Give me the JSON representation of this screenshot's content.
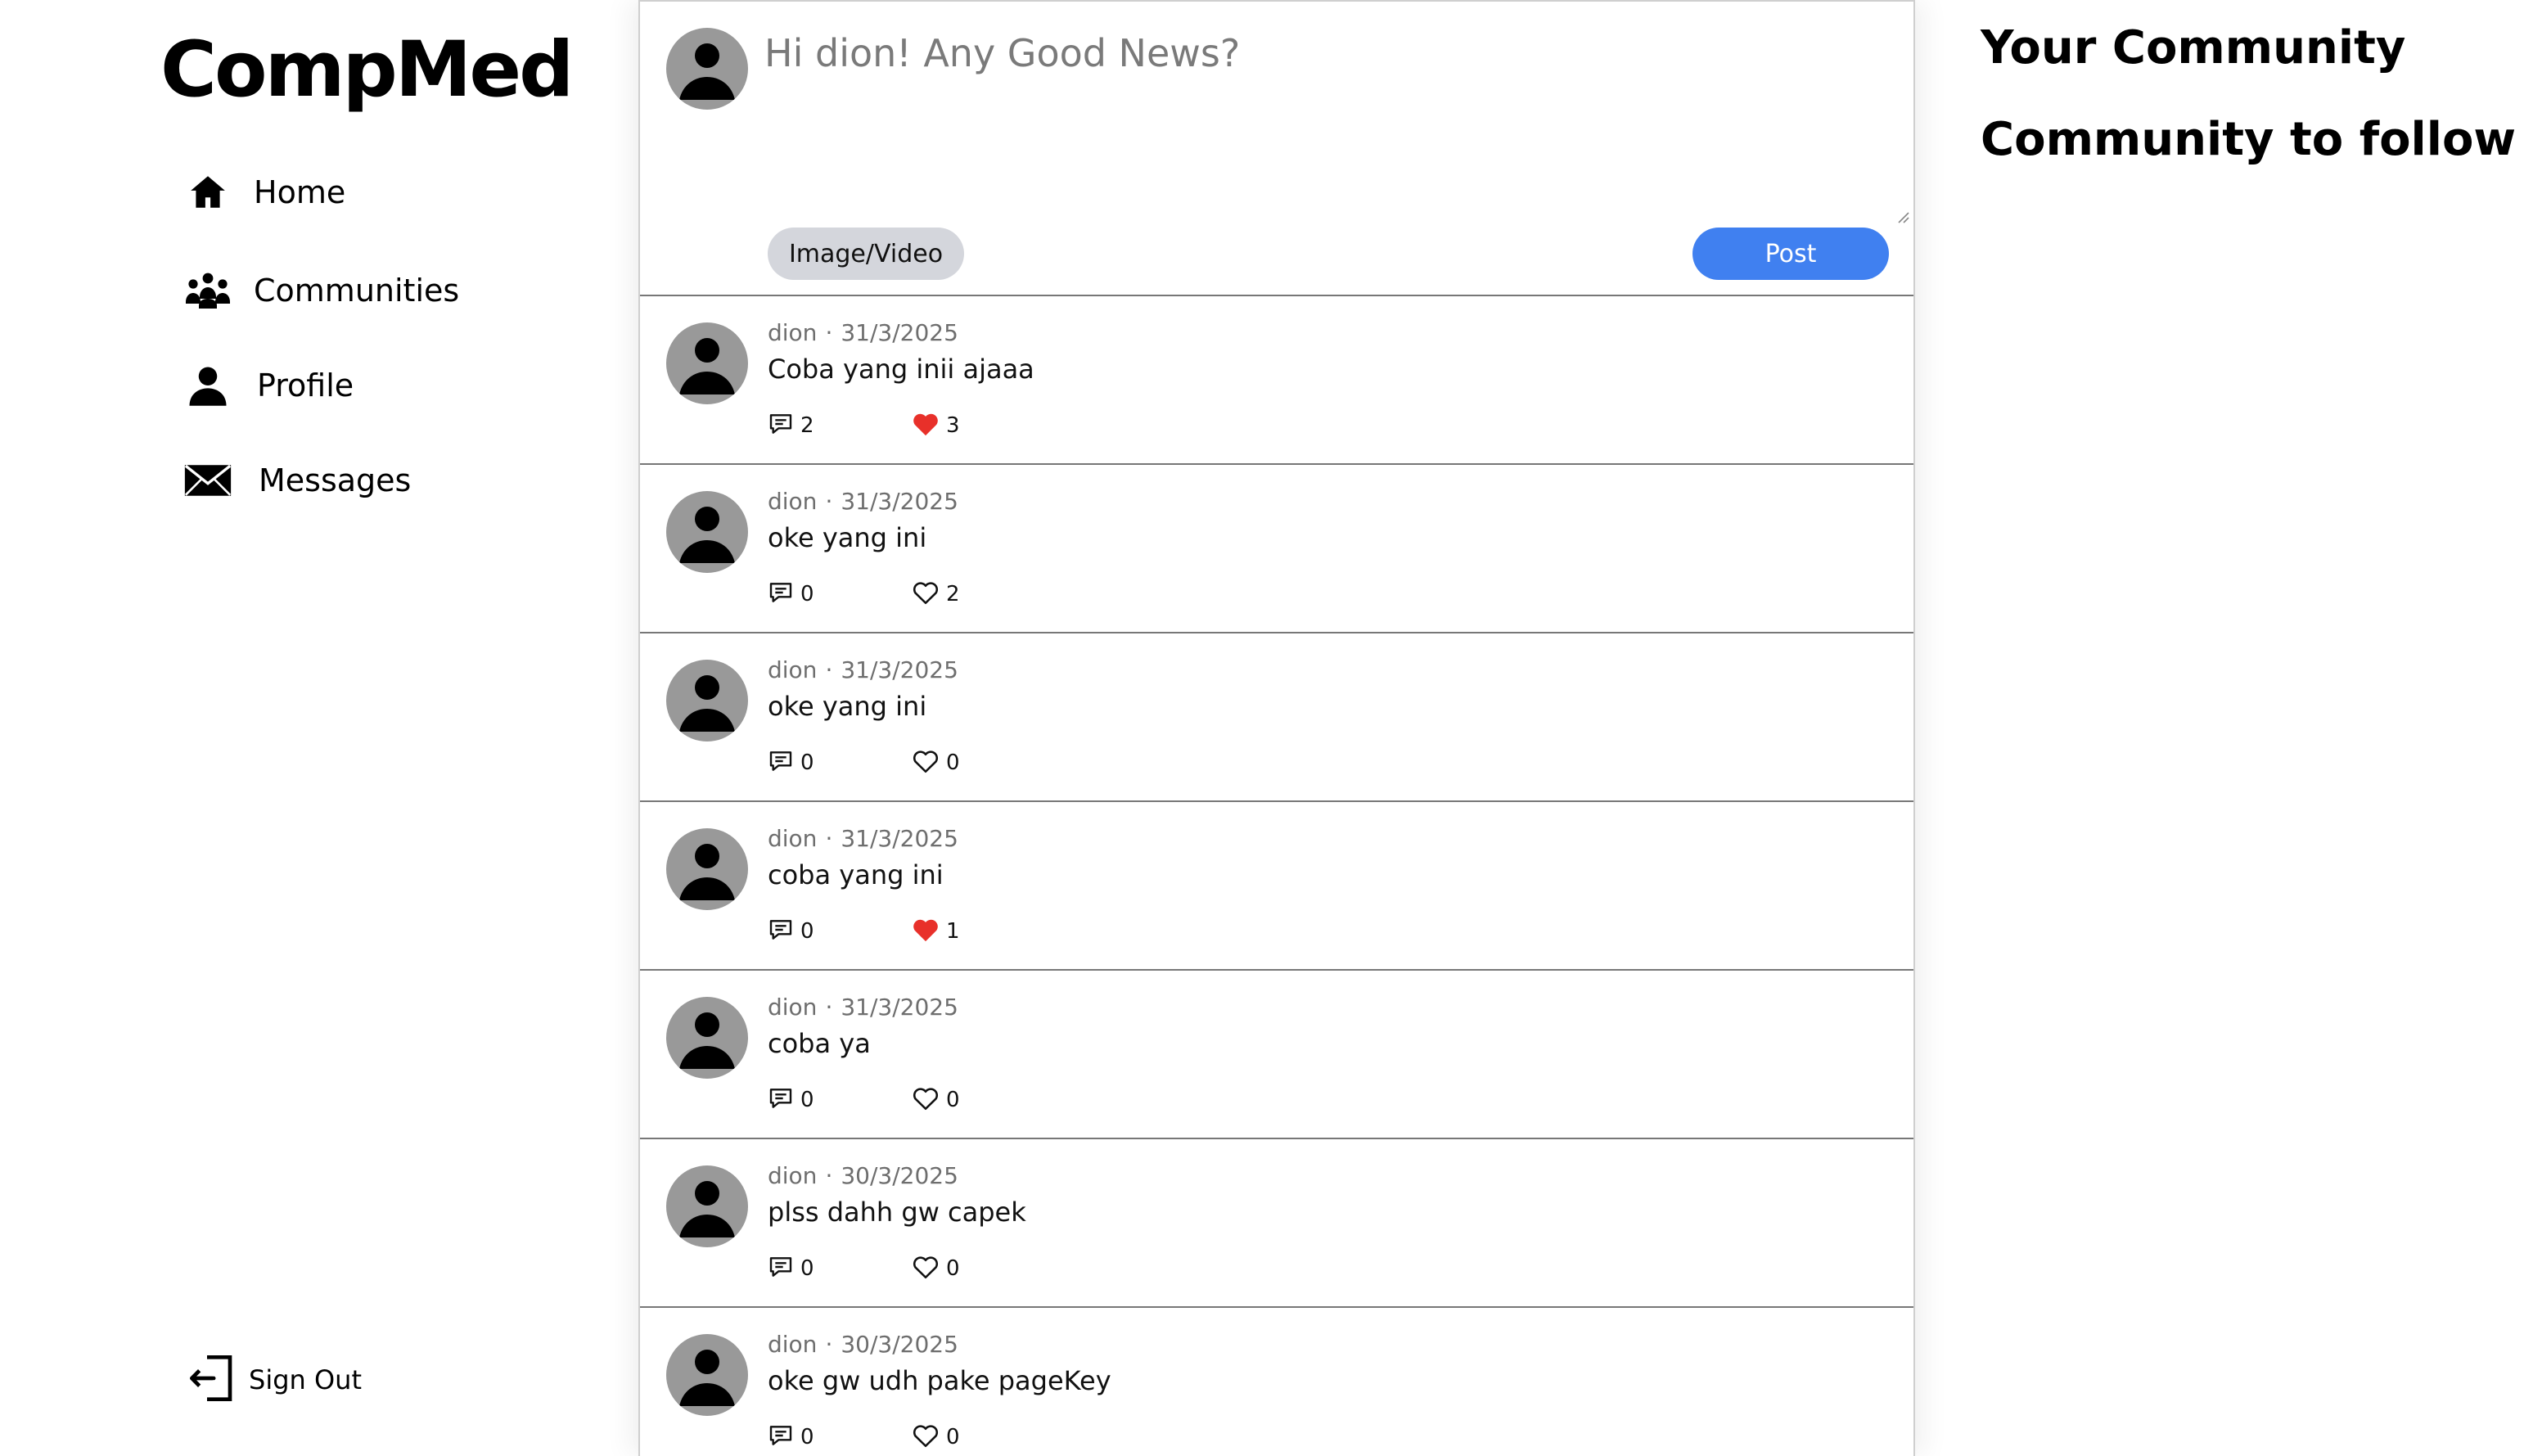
{
  "app": {
    "logo": "CompMed"
  },
  "sidebar": {
    "items": [
      {
        "label": "Home",
        "icon": "home-icon"
      },
      {
        "label": "Communities",
        "icon": "people-group-icon"
      },
      {
        "label": "Profile",
        "icon": "user-icon"
      },
      {
        "label": "Messages",
        "icon": "envelope-icon"
      }
    ],
    "sign_out": {
      "label": "Sign Out",
      "icon": "sign-out-icon"
    }
  },
  "composer": {
    "placeholder": "Hi dion! Any Good News?",
    "media_label": "Image/Video",
    "post_label": "Post"
  },
  "posts": [
    {
      "author": "dion",
      "date": "31/3/2025",
      "text": "Coba yang inii ajaaa",
      "comments": "2",
      "likes": "3",
      "liked": true
    },
    {
      "author": "dion",
      "date": "31/3/2025",
      "text": "oke yang ini",
      "comments": "0",
      "likes": "2",
      "liked": false
    },
    {
      "author": "dion",
      "date": "31/3/2025",
      "text": "oke yang ini",
      "comments": "0",
      "likes": "0",
      "liked": false
    },
    {
      "author": "dion",
      "date": "31/3/2025",
      "text": "coba yang ini",
      "comments": "0",
      "likes": "1",
      "liked": true
    },
    {
      "author": "dion",
      "date": "31/3/2025",
      "text": "coba ya",
      "comments": "0",
      "likes": "0",
      "liked": false
    },
    {
      "author": "dion",
      "date": "30/3/2025",
      "text": "plss dahh gw capek",
      "comments": "0",
      "likes": "0",
      "liked": false
    },
    {
      "author": "dion",
      "date": "30/3/2025",
      "text": "oke gw udh pake pageKey",
      "comments": "0",
      "likes": "0",
      "liked": false
    }
  ],
  "right_panel": {
    "your_community": "Your Community",
    "community_to_follow": "Community to follow"
  },
  "colors": {
    "accent": "#4080f0",
    "liked_heart": "#e8302a",
    "avatar_bg": "#999999"
  }
}
